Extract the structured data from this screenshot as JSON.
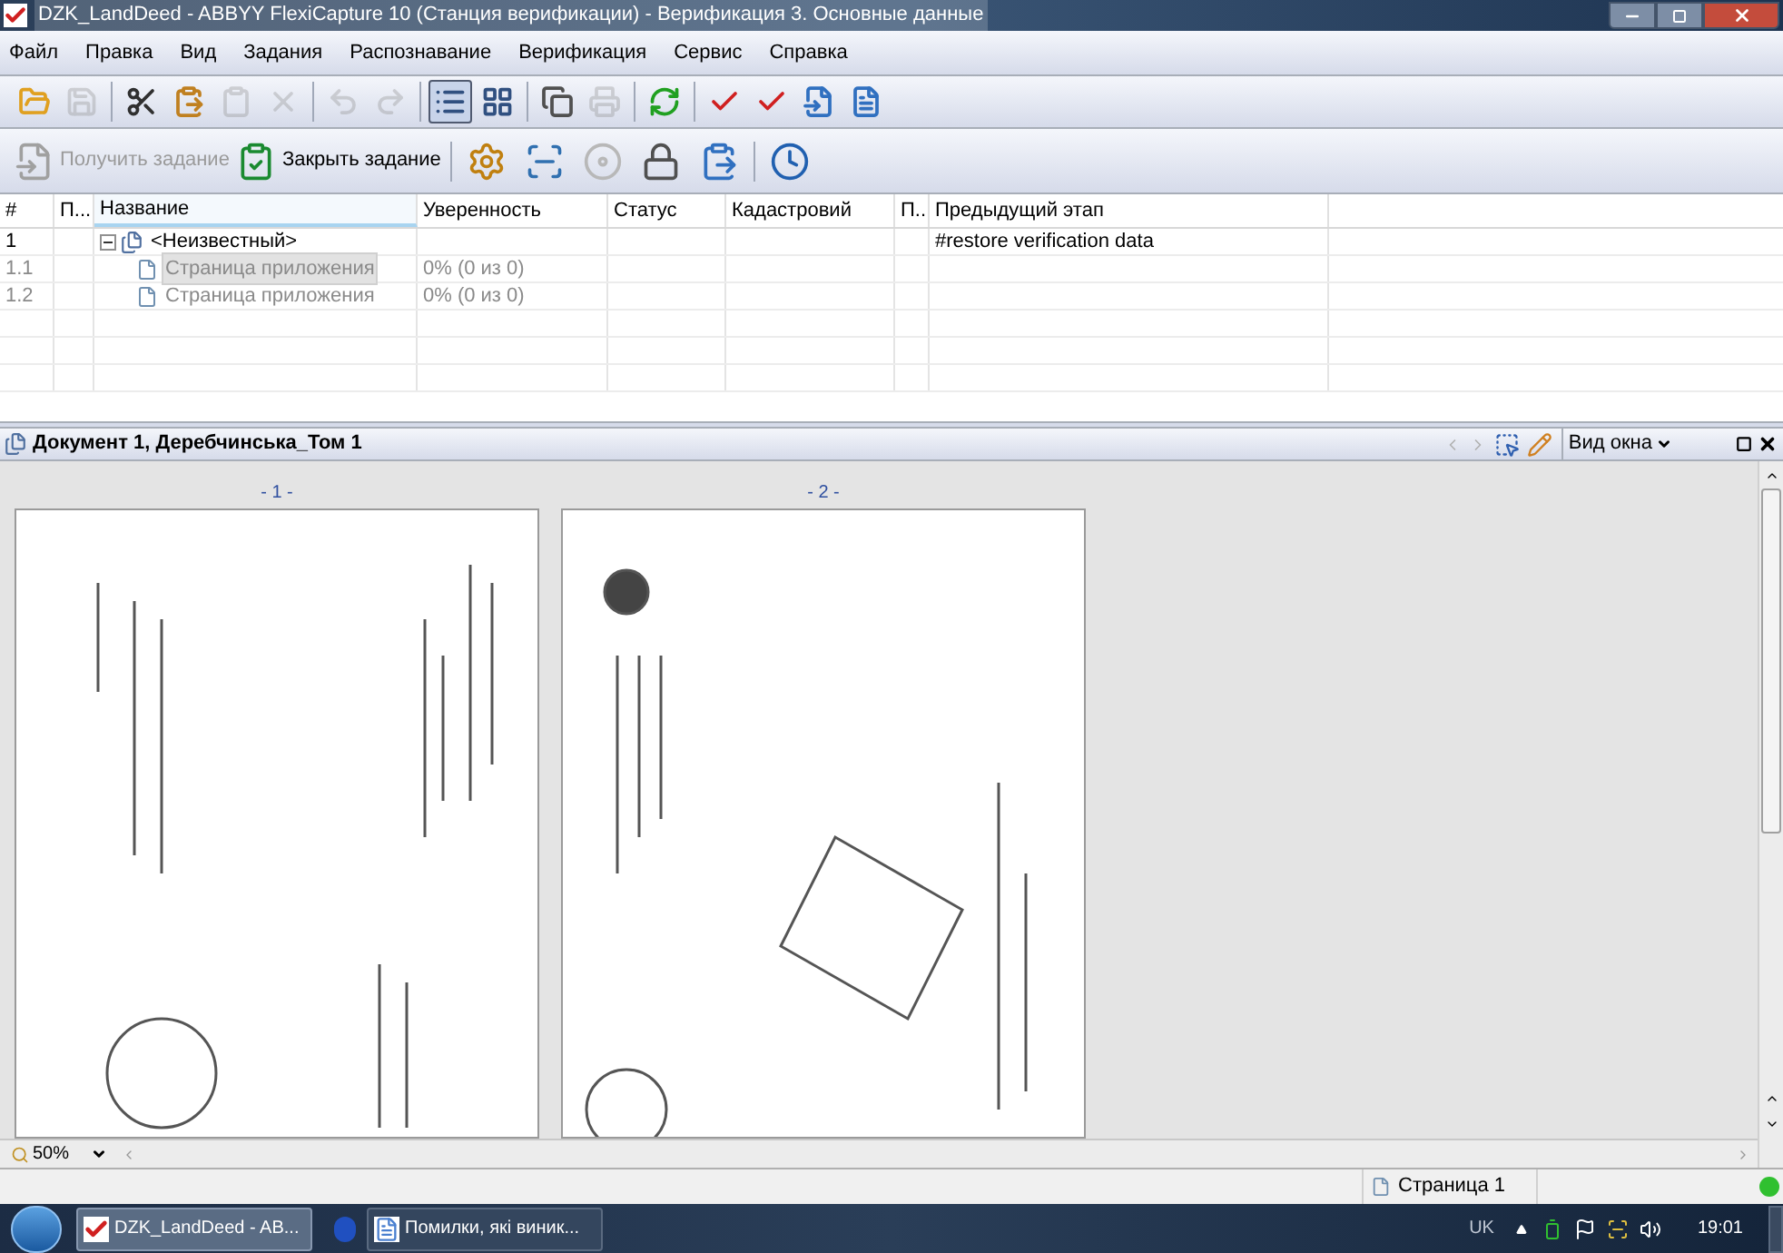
{
  "window": {
    "title": "DZK_LandDeed - ABBYY FlexiCapture 10 (Станция верификации) - Верификация 3. Основные данные"
  },
  "menu": [
    "Файл",
    "Правка",
    "Вид",
    "Задания",
    "Распознавание",
    "Верификация",
    "Сервис",
    "Справка"
  ],
  "toolbar": [
    {
      "buttons": [
        {
          "disabled": false,
          "selected": false
        },
        {
          "disabled": true,
          "selected": false
        }
      ]
    },
    {
      "buttons": [
        {
          "disabled": false,
          "selected": false
        },
        {
          "disabled": false,
          "selected": false
        },
        {
          "disabled": true,
          "selected": false
        },
        {
          "disabled": true,
          "selected": false
        }
      ]
    },
    {
      "buttons": [
        {
          "disabled": true,
          "selected": false
        },
        {
          "disabled": true,
          "selected": false
        }
      ]
    },
    {
      "buttons": [
        {
          "disabled": false,
          "selected": true
        },
        {
          "disabled": false,
          "selected": false
        }
      ]
    },
    {
      "buttons": [
        {
          "disabled": false,
          "selected": false
        },
        {
          "disabled": true,
          "selected": false
        }
      ]
    },
    {
      "buttons": [
        {
          "disabled": false,
          "selected": false
        }
      ]
    },
    {
      "buttons": [
        {
          "disabled": false,
          "selected": false
        },
        {
          "disabled": false,
          "selected": false
        },
        {
          "disabled": false,
          "selected": false
        },
        {
          "disabled": false,
          "selected": false
        }
      ]
    }
  ],
  "task_toolbar": {
    "get_task": {
      "label": "Получить задание",
      "disabled": true
    },
    "close_task": {
      "label": "Закрыть задание",
      "disabled": false
    },
    "buttons": [
      {
        "disabled": false
      },
      {
        "disabled": false
      },
      {
        "disabled": true
      },
      {
        "disabled": false
      },
      {
        "disabled": false
      },
      {
        "disabled": false
      }
    ]
  },
  "table": {
    "columns": [
      {
        "label": "#",
        "sorted": false
      },
      {
        "label": "П...",
        "sorted": false
      },
      {
        "label": "Название",
        "sorted": true
      },
      {
        "label": "Уверенность",
        "sorted": false
      },
      {
        "label": "Статус",
        "sorted": false
      },
      {
        "label": "Кадастровий",
        "sorted": false
      },
      {
        "label": "П..",
        "sorted": false
      },
      {
        "label": "Предыдущий этап",
        "sorted": false
      }
    ],
    "rows": [
      {
        "number": "1",
        "name": "<Неизвестный>",
        "expanded": true,
        "disabled": false,
        "previous_stage": "#restore verification data",
        "children": [
          {
            "number": "1.1",
            "name": "Страница приложения",
            "confidence": "0% (0 из 0)",
            "disabled": true,
            "selected": true
          },
          {
            "number": "1.2",
            "name": "Страница приложения",
            "confidence": "0% (0 из 0)",
            "disabled": true,
            "selected": false
          }
        ]
      }
    ]
  },
  "document": {
    "title": "Документ 1, Деребчинська_Том 1",
    "view_menu": "Вид окна",
    "pages": [
      {
        "label": "- 1 -"
      },
      {
        "label": "- 2 -"
      }
    ],
    "zoom": "50%"
  },
  "status_bar": {
    "page": "Страница 1"
  },
  "taskbar": {
    "buttons": [
      {
        "label": "DZK_LandDeed - AB...",
        "kind": "flexicapture",
        "selected": true
      },
      {
        "label": "Помилки, які виник...",
        "kind": "word",
        "selected": false
      }
    ],
    "language": "UK",
    "time": "19:01"
  }
}
